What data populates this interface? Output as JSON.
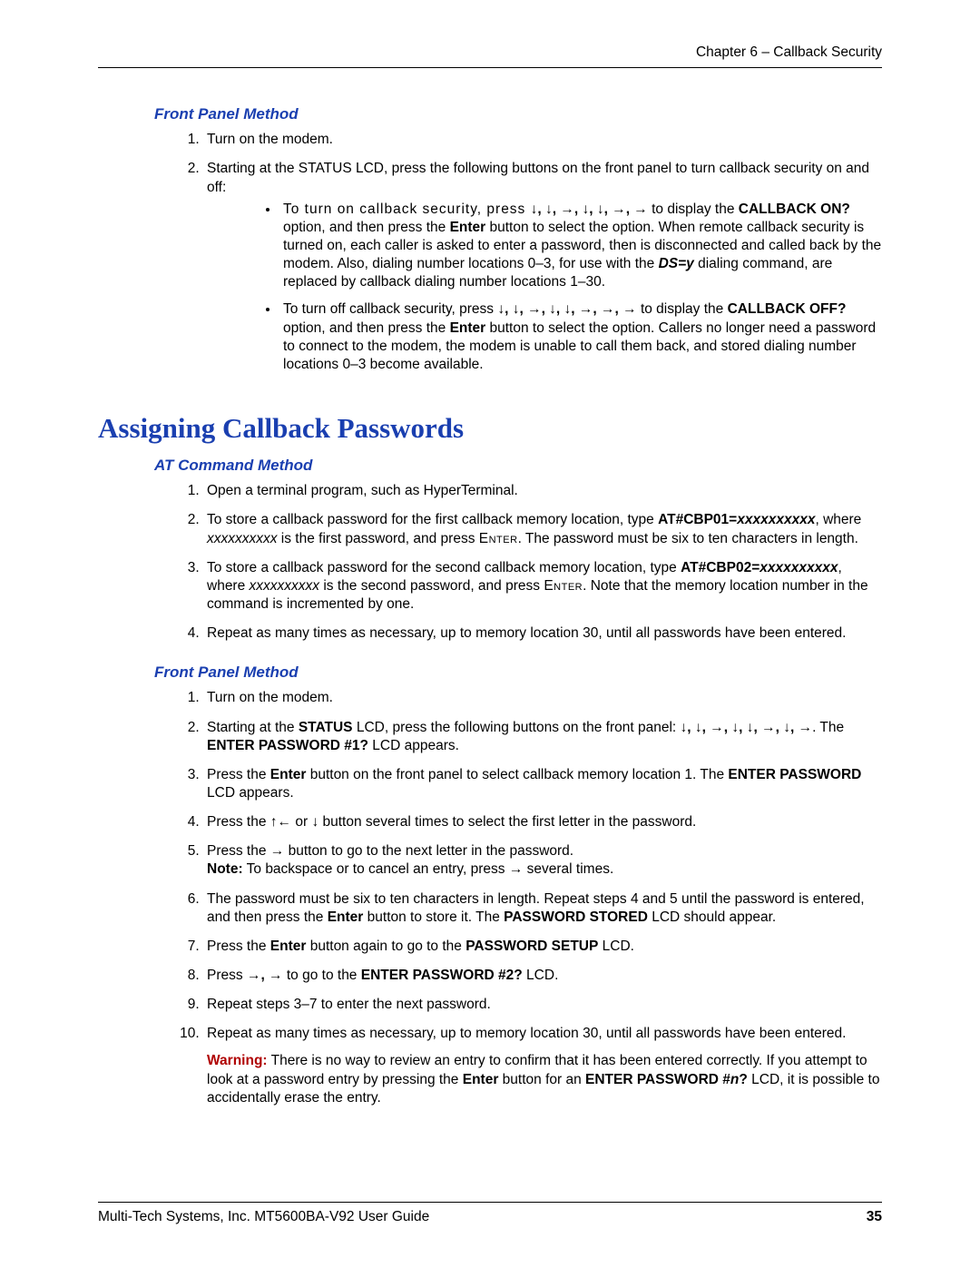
{
  "header": {
    "chapter": "Chapter 6 – Callback Security"
  },
  "s1": {
    "heading": "Front Panel Method",
    "li1": "Turn on the modem.",
    "li2_lead": "Starting at the STATUS LCD, press the following buttons on the front panel to turn callback security on and off:",
    "b1_a": "To turn on callback security, press ",
    "b1_arrows": "↓, ↓, →, ↓, ↓, →, →",
    "b1_b": " to display the ",
    "b1_opt": "CALLBACK ON?",
    "b1_c": " option, and then press the ",
    "b1_enter": "Enter",
    "b1_d": " button to select the option. When remote callback security is turned on, each caller is asked to enter a password, then is disconnected and called back by the modem. Also, dialing number locations 0–3, for use with the ",
    "b1_dsy": "DS=y",
    "b1_e": " dialing command, are replaced by callback dialing number locations 1–30.",
    "b2_a": "To turn off callback security, press ",
    "b2_arrows": "↓, ↓, →, ↓, ↓, →, →, →",
    "b2_b": " to display the ",
    "b2_opt": "CALLBACK OFF?",
    "b2_c": " option, and then press the ",
    "b2_enter": "Enter",
    "b2_d": " button to select the option. Callers no longer need a password to connect to the modem, the modem is unable to call them back, and stored dialing number locations 0–3 become available."
  },
  "h2": "Assigning Callback Passwords",
  "s2": {
    "heading": "AT Command Method",
    "li1": "Open a terminal program, such as HyperTerminal.",
    "li2_a": "To store a callback password for the first callback memory location, type ",
    "li2_cmd": "AT#CBP01=",
    "li2_x": "xxxxxxxxxx",
    "li2_b": ", where ",
    "li2_x2": "xxxxxxxxxx",
    "li2_c": " is the first password, and press ",
    "li2_enter": "Enter",
    "li2_d": ". The password must be six to ten characters in length.",
    "li3_a": "To store a callback password for the second callback memory location, type ",
    "li3_cmd": "AT#CBP02=",
    "li3_x": "xxxxxxxxxx",
    "li3_b": ", where ",
    "li3_x2": "xxxxxxxxxx",
    "li3_c": " is the second password, and press ",
    "li3_enter": "Enter",
    "li3_d": ". Note that the memory location number in the command is incremented by one.",
    "li4": "Repeat as many times as necessary, up to memory location 30, until all passwords have been entered."
  },
  "s3": {
    "heading": "Front Panel Method",
    "li1": "Turn on the modem.",
    "li2_a": "Starting at the ",
    "li2_status": "STATUS",
    "li2_b": " LCD, press the following buttons on the front panel: ",
    "li2_arrows1": "↓, ↓, →, ↓, ↓, →, ↓, →",
    "li2_c": ". The ",
    "li2_ep1": "ENTER PASSWORD #1?",
    "li2_d": " LCD appears.",
    "li3_a": "Press the ",
    "li3_enter": "Enter",
    "li3_b": " button on the front panel to select callback memory location 1. The ",
    "li3_ep": "ENTER PASSWORD",
    "li3_c": " LCD appears.",
    "li4_a": "Press the ",
    "li4_arrows": "↑← ",
    "li4_or": "or ",
    "li4_down": "↓",
    "li4_b": " button several times to select the first letter in the password.",
    "li5_a": "Press the ",
    "li5_arrow": "→",
    "li5_b": " button to go to the next letter in the password.",
    "li5_note_lead": "Note:",
    "li5_note": " To backspace or to cancel an entry, press ",
    "li5_note_arrow": "→",
    "li5_note_tail": " several times.",
    "li6_a": "The password must be six to ten characters in length. Repeat steps 4 and 5 until the password is entered, and then press the ",
    "li6_enter": "Enter",
    "li6_b": " button to store it. The ",
    "li6_ps": "PASSWORD STORED",
    "li6_c": " LCD should appear.",
    "li7_a": "Press the ",
    "li7_enter": "Enter",
    "li7_b": " button again to go to the ",
    "li7_lcd": "PASSWORD SETUP",
    "li7_c": " LCD.",
    "li8_a": "Press ",
    "li8_arrows": "→, →",
    "li8_b": " to go to the ",
    "li8_lcd": "ENTER PASSWORD #2?",
    "li8_c": " LCD.",
    "li9": "Repeat steps 3–7 to enter the next password.",
    "li10": "Repeat as many times as necessary, up to memory location 30, until all passwords have been entered.",
    "warn_lead": "Warning:",
    "warn_a": " There is no way to review an entry to confirm that it has been entered correctly. If you attempt to look at a password entry by pressing the ",
    "warn_enter": "Enter",
    "warn_b": " button for an ",
    "warn_lcd_a": "ENTER PASSWORD #",
    "warn_n": "n",
    "warn_lcd_b": "?",
    "warn_c": " LCD, it is possible to accidentally erase the entry."
  },
  "footer": {
    "left": "Multi-Tech Systems, Inc. MT5600BA-V92 User Guide",
    "page": "35"
  }
}
